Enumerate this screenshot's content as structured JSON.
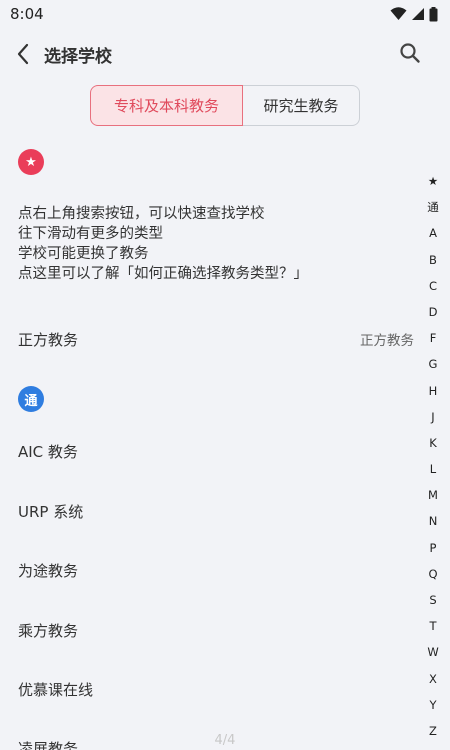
{
  "status_bar": {
    "time": "8:04",
    "icons": [
      "wifi-icon",
      "cellular-icon",
      "battery-icon"
    ]
  },
  "app_bar": {
    "title": "选择学校",
    "back_icon": "chevron-left-icon",
    "search_icon": "search-icon"
  },
  "tabs": [
    {
      "label": "专科及本科教务",
      "selected": true
    },
    {
      "label": "研究生教务",
      "selected": false
    }
  ],
  "sections": {
    "star_badge": "★",
    "tong_badge": "通"
  },
  "tips": [
    "点右上角搜索按钮，可以快速查找学校",
    "往下滑动有更多的类型",
    "学校可能更换了教务",
    "点这里可以了解「如何正确选择教务类型？」"
  ],
  "starred_row": {
    "label": "正方教务",
    "right": "正方教务"
  },
  "general_rows": [
    "AIC 教务",
    "URP 系统",
    "为途教务",
    "乘方教务",
    "优慕课在线",
    "凌展教务"
  ],
  "index_letters": [
    "★",
    "通",
    "A",
    "B",
    "C",
    "D",
    "F",
    "G",
    "H",
    "J",
    "K",
    "L",
    "M",
    "N",
    "P",
    "Q",
    "S",
    "T",
    "W",
    "X",
    "Y",
    "Z"
  ],
  "page_indicator": "4/4",
  "colors": {
    "accent_red": "#e04a5c",
    "badge_red": "#ea3d59",
    "badge_blue": "#2f7de0",
    "background": "#f2f3f7"
  }
}
